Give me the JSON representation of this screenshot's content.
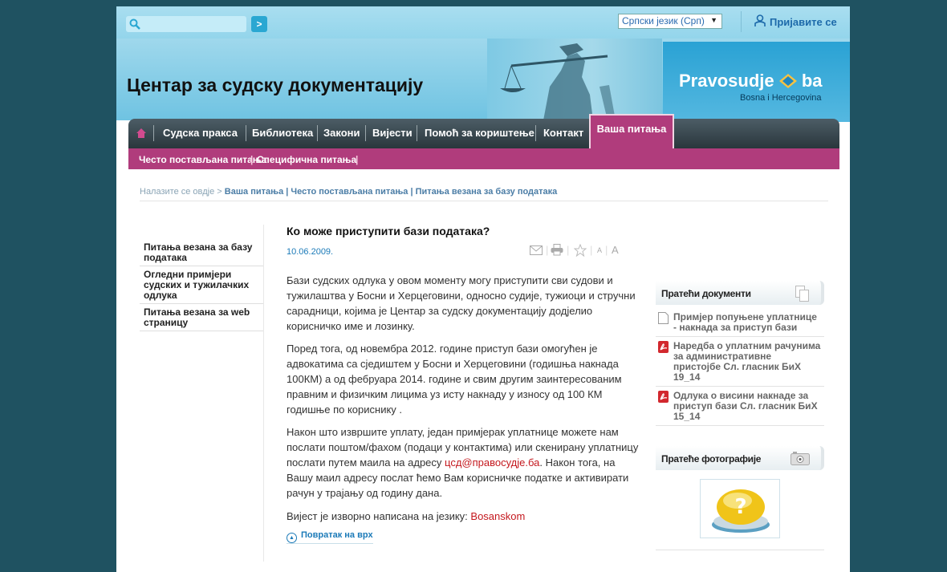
{
  "search": {
    "placeholder": "",
    "go_label": ">"
  },
  "language": {
    "selected": "Српски језик (Срп)"
  },
  "login": {
    "label": "Пријавите се"
  },
  "site": {
    "title": "Центар за судску документацију"
  },
  "logo": {
    "name": "Pravosudje",
    "tld": "ba",
    "subtitle": "Bosna i Hercegovina"
  },
  "nav": {
    "items": [
      "Судска пракса",
      "Библиотека",
      "Закони",
      "Вијести",
      "Помоћ за кориштење",
      "Контакт"
    ],
    "active": "Ваша питања"
  },
  "subnav": {
    "items": [
      "Често постављана питања",
      "Специфична питања"
    ]
  },
  "breadcrumb": {
    "prefix": "Налазите се овдје >",
    "path": "Ваша питања | Често постављана питања | Питања везана за базу података"
  },
  "left_nav": {
    "items": [
      "Питања везана за базу података",
      "Огледни примјери судских и тужилачких одлука",
      "Питања везана за web страницу"
    ]
  },
  "article": {
    "title": "Ко може приступити бази података?",
    "date": "10.06.2009.",
    "tools": {
      "small_a": "A",
      "large_a": "A"
    },
    "p1": "Бази судских одлука у овом моменту могу приступити сви судови и тужилаштва у Босни и Херцеговини, односно судије, тужиоци и стручни сарадници, којима је Центар за судску документацију додјелио корисничко име и лозинку.",
    "p2": "Поред тога,  од новембра 2012. године приступ бази омогућен је адвокатима са сједиштем у Босни и Херцеговини (годишња накнада 100КМ) а од фебруара 2014. године и свим другим заинтересованим правним и физичким лицима уз исту накнаду у износу од 100 КМ годишње по кориснику .",
    "p3_before": "Након што извршите уплату, један примјерак уплатнице можете нам послати поштом/фахом (подаци у контактима) или скенирану уплатницу послати путем маила на адресу ",
    "p3_email": "цсд@правосудје.ба",
    "p3_after": ". Након тога, на Вашу маил адресу послат ћемо Вам корисничке податке и активирати рачун у трајању од годину дана.",
    "source_prefix": "Вијест је изворно написана на језику: ",
    "source_lang": "Bosanskom",
    "back_to_top": "Повратак на врх"
  },
  "related_docs": {
    "title": "Пратећи документи",
    "items": [
      {
        "label": "Примјер попуњене уплатнице - накнада за приступ бази",
        "icon": "document-icon"
      },
      {
        "label": "Наредба о уплатним рачунима за административне пристојбе Сл. гласник БиХ 19_14",
        "icon": "pdf-icon"
      },
      {
        "label": "Одлука о висини накнаде за приступ бази Сл. гласник БиХ 15_14",
        "icon": "pdf-icon"
      }
    ]
  },
  "related_photos": {
    "title": "Пратеће фотографије"
  },
  "colors": {
    "accent": "#b03c7c",
    "nav_dark": "#2a363c",
    "link": "#1b7ab8",
    "background": "#1f5261"
  }
}
